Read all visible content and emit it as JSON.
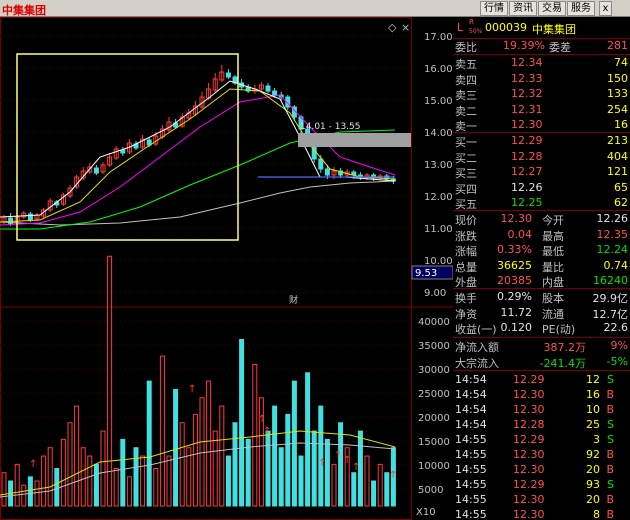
{
  "window": {
    "title": "中集集团",
    "buttons": {
      "hq": "行情",
      "zx": "资讯",
      "jy": "交易",
      "fw": "服务",
      "close": "x"
    }
  },
  "chart": {
    "price_ticks": [
      "17.00",
      "16.00",
      "15.00",
      "14.00",
      "13.00",
      "12.00",
      "11.00",
      "10.00",
      "9.00"
    ],
    "volume_ticks": [
      "40000",
      "35000",
      "30000",
      "25000",
      "20000",
      "15000",
      "10000",
      "5000"
    ],
    "current_price_tag": "9.53",
    "range_label": "14.01 - 13.55",
    "finance_marker": "财",
    "volume_unit": "X10",
    "colors": {
      "up": "#ff3a3a",
      "down": "#40e0e0",
      "ma5": "#ffffff",
      "ma10": "#e0e000",
      "ma20": "#ff00ff",
      "ma60": "#00ff00",
      "ma120": "#c0c0c0",
      "selection": "#ffff80"
    }
  },
  "quote": {
    "prefix": "L",
    "code": "000039",
    "name": "中集集团",
    "weibi_label": "委比",
    "weibi_value": "19.39%",
    "weicha_label": "委差",
    "weicha_value": "281",
    "sell": [
      {
        "label": "卖五",
        "price": "12.34",
        "vol": "74"
      },
      {
        "label": "卖四",
        "price": "12.33",
        "vol": "150"
      },
      {
        "label": "卖三",
        "price": "12.32",
        "vol": "133"
      },
      {
        "label": "卖二",
        "price": "12.31",
        "vol": "254"
      },
      {
        "label": "卖一",
        "price": "12.30",
        "vol": "16"
      }
    ],
    "buy": [
      {
        "label": "买一",
        "price": "12.29",
        "vol": "213"
      },
      {
        "label": "买二",
        "price": "12.28",
        "vol": "404"
      },
      {
        "label": "买三",
        "price": "12.27",
        "vol": "121"
      },
      {
        "label": "买四",
        "price": "12.26",
        "vol": "65"
      },
      {
        "label": "买五",
        "price": "12.25",
        "vol": "62"
      }
    ],
    "stats": [
      {
        "l1": "现价",
        "v1": "12.30",
        "l2": "今开",
        "v2": "12.26"
      },
      {
        "l1": "涨跌",
        "v1": "0.04",
        "l2": "最高",
        "v2": "12.35"
      },
      {
        "l1": "涨幅",
        "v1": "0.33%",
        "l2": "最低",
        "v2": "12.24"
      },
      {
        "l1": "总量",
        "v1": "36625",
        "l2": "量比",
        "v2": "0.74"
      },
      {
        "l1": "外盘",
        "v1": "20385",
        "l2": "内盘",
        "v2": "16240"
      }
    ],
    "stats2": [
      {
        "l1": "换手",
        "v1": "0.29%",
        "l2": "股本",
        "v2": "29.9亿"
      },
      {
        "l1": "净资",
        "v1": "11.72",
        "l2": "流通",
        "v2": "12.7亿"
      },
      {
        "l1": "收益(一)",
        "v1": "0.120",
        "l2": "PE(动)",
        "v2": "22.6"
      }
    ],
    "flows": [
      {
        "label": "净流入额",
        "value": "387.2万",
        "pct": "9%"
      },
      {
        "label": "大宗流入",
        "value": "-241.4万",
        "pct": "-5%"
      }
    ],
    "ticks": [
      {
        "time": "14:54",
        "price": "12.29",
        "vol": "12",
        "side": "S"
      },
      {
        "time": "14:54",
        "price": "12.30",
        "vol": "16",
        "side": "B"
      },
      {
        "time": "14:54",
        "price": "12.30",
        "vol": "10",
        "side": "B"
      },
      {
        "time": "14:54",
        "price": "12.28",
        "vol": "25",
        "side": "S"
      },
      {
        "time": "14:55",
        "price": "12.29",
        "vol": "3",
        "side": "S"
      },
      {
        "time": "14:55",
        "price": "12.30",
        "vol": "92",
        "side": "B"
      },
      {
        "time": "14:55",
        "price": "12.30",
        "vol": "20",
        "side": "B"
      },
      {
        "time": "14:55",
        "price": "12.29",
        "vol": "93",
        "side": "S"
      },
      {
        "time": "14:55",
        "price": "12.30",
        "vol": "20",
        "side": "B"
      },
      {
        "time": "14:55",
        "price": "12.30",
        "vol": "8",
        "side": "B"
      }
    ]
  }
}
